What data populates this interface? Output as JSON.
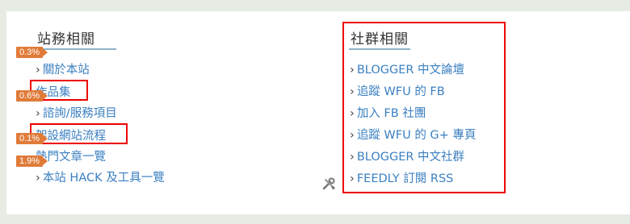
{
  "site_links": {
    "title": "站務相關",
    "items": [
      {
        "label": "關於本站",
        "badge": "0.3%"
      },
      {
        "label": "作品集",
        "badge": "0.6%"
      },
      {
        "label": "諮詢/服務項目",
        "badge": ""
      },
      {
        "label": "架設網站流程",
        "badge": "0.1%"
      },
      {
        "label": "熱門文章一覽",
        "badge": "1.9%"
      },
      {
        "label": "本站 HACK 及工具一覽",
        "badge": ""
      }
    ]
  },
  "community_links": {
    "title": "社群相關",
    "items": [
      {
        "label": "BLOGGER 中文論壇"
      },
      {
        "label": "追蹤 WFU 的 FB"
      },
      {
        "label": "加入 FB 社團"
      },
      {
        "label": "追蹤 WFU 的 G+ 專頁"
      },
      {
        "label": "BLOGGER 中文社群"
      },
      {
        "label": "FEEDLY 訂閱 RSS"
      }
    ]
  },
  "icons": {
    "tool": "tools-icon"
  },
  "colors": {
    "link": "#3a7fc1",
    "highlight": "#e00000",
    "badge": "#e07b39"
  }
}
